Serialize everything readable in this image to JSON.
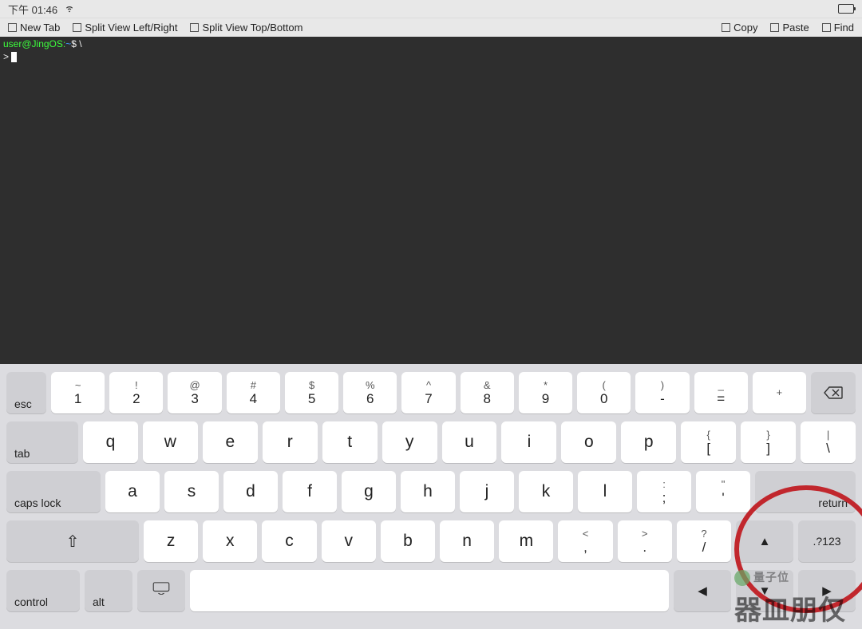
{
  "status": {
    "time": "下午 01:46"
  },
  "toolbar": {
    "new_tab": "New Tab",
    "split_lr": "Split View Left/Right",
    "split_tb": "Split View Top/Bottom",
    "copy": "Copy",
    "paste": "Paste",
    "find": "Find"
  },
  "terminal": {
    "prompt_userhost": "user@JingOS:",
    "prompt_path": "~",
    "prompt_symbol": "$",
    "line1_tail": "\\",
    "line2_prefix": ">"
  },
  "keyboard": {
    "row1": {
      "esc": "esc",
      "keys": [
        {
          "upper": "~",
          "lower": "1"
        },
        {
          "upper": "!",
          "lower": "2"
        },
        {
          "upper": "@",
          "lower": "3"
        },
        {
          "upper": "#",
          "lower": "4"
        },
        {
          "upper": "$",
          "lower": "5"
        },
        {
          "upper": "%",
          "lower": "6"
        },
        {
          "upper": "^",
          "lower": "7"
        },
        {
          "upper": "&",
          "lower": "8"
        },
        {
          "upper": "*",
          "lower": "9"
        },
        {
          "upper": "(",
          "lower": "0"
        },
        {
          "upper": ")",
          "lower": "-"
        },
        {
          "upper": "_",
          "lower": "="
        },
        {
          "upper": "+",
          "lower": ""
        }
      ]
    },
    "row2": {
      "tab": "tab",
      "letters": [
        "q",
        "w",
        "e",
        "r",
        "t",
        "y",
        "u",
        "i",
        "o",
        "p"
      ],
      "brackets": [
        {
          "upper": "{",
          "lower": "["
        },
        {
          "upper": "}",
          "lower": "]"
        },
        {
          "upper": "|",
          "lower": "\\"
        }
      ]
    },
    "row3": {
      "caps": "caps lock",
      "letters": [
        "a",
        "s",
        "d",
        "f",
        "g",
        "h",
        "j",
        "k",
        "l"
      ],
      "punct": [
        {
          "upper": ":",
          "lower": ";"
        },
        {
          "upper": "\"",
          "lower": "'"
        }
      ],
      "ret": "return"
    },
    "row4": {
      "letters": [
        "z",
        "x",
        "c",
        "v",
        "b",
        "n",
        "m"
      ],
      "punct": [
        {
          "upper": "<",
          "lower": ","
        },
        {
          "upper": ">",
          "lower": "."
        },
        {
          "upper": "?",
          "lower": "/"
        }
      ],
      "numtoggle": ".?123"
    },
    "row5": {
      "control": "control",
      "alt": "alt"
    }
  },
  "watermark": {
    "small": "量子位",
    "large": "器皿朋仅"
  }
}
